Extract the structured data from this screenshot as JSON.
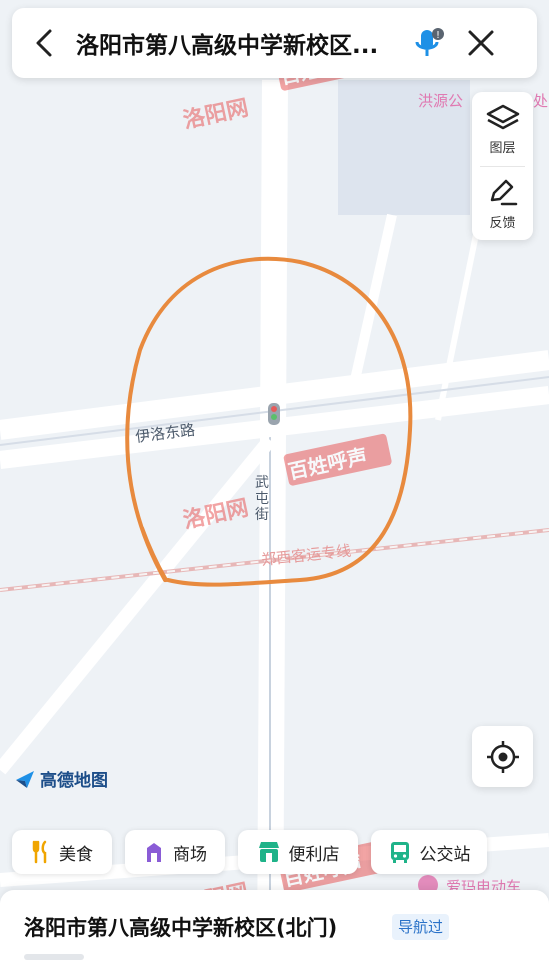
{
  "search": {
    "title": "洛阳市第八高级中学新校区..."
  },
  "side": {
    "layers_label": "图层",
    "feedback_label": "反馈"
  },
  "map": {
    "road_yiluo": "伊洛东路",
    "street_vertical": "武屯街",
    "rail_label": "郑西客运专线",
    "poi_top": "洪源公",
    "poi_top2": "处",
    "poi_bottom": "爱玛电动车"
  },
  "watermark": {
    "text1": "洛阳网",
    "text2": "百姓呼声"
  },
  "logo": {
    "text": "高德地图"
  },
  "chips": [
    {
      "label": "美食",
      "icon": "fork-knife-icon"
    },
    {
      "label": "商场",
      "icon": "mall-icon"
    },
    {
      "label": "便利店",
      "icon": "store-icon"
    },
    {
      "label": "公交站",
      "icon": "bus-icon"
    }
  ],
  "place": {
    "title": "洛阳市第八高级中学新校区(北门)",
    "tag": "导航过"
  },
  "colors": {
    "accent": "#2a72c8",
    "circle": "#e88a3e",
    "rail": "#e7b7b7",
    "road": "#ffffff",
    "watermark": "#e85a5a"
  }
}
